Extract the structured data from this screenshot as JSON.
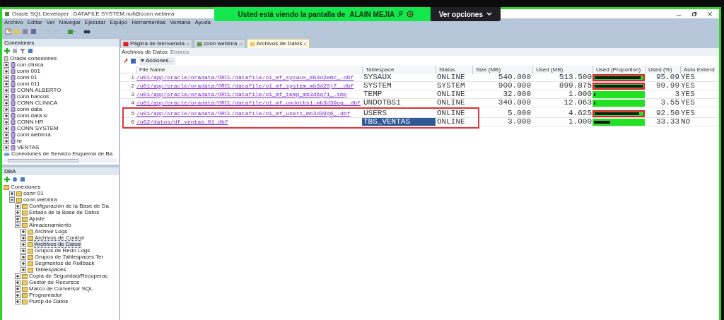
{
  "banner": {
    "text": "Usted está viendo la pantalla de",
    "presenter": "ALAIN MEJIA",
    "button": "Ver opciones"
  },
  "window": {
    "title": "Oracle SQL Developer : DATAFILE SYSTEM.null@conn webinra"
  },
  "menu": [
    "Archivo",
    "Editar",
    "Ver",
    "Navegar",
    "Ejecutar",
    "Equipo",
    "Herramientas",
    "Ventana",
    "Ayuda"
  ],
  "connections_panel": {
    "title": "Conexiones",
    "items": [
      {
        "kind": "root",
        "label": "Oracle conexiones"
      },
      {
        "kind": "connection",
        "label": "con clinica",
        "expanded": false
      },
      {
        "kind": "connection",
        "label": "conn 001",
        "expanded": false
      },
      {
        "kind": "connection",
        "label": "conn 01",
        "expanded": false
      },
      {
        "kind": "connection",
        "label": "conn 011",
        "expanded": false
      },
      {
        "kind": "connection",
        "label": "CONN ALBERTO",
        "expanded": false
      },
      {
        "kind": "connection",
        "label": "conn bancos",
        "expanded": false
      },
      {
        "kind": "connection",
        "label": "CONN CLINICA",
        "expanded": false
      },
      {
        "kind": "connection",
        "label": "conn data",
        "expanded": false
      },
      {
        "kind": "connection",
        "label": "conn data si",
        "expanded": false
      },
      {
        "kind": "connection",
        "label": "CONN HR",
        "expanded": false
      },
      {
        "kind": "connection",
        "label": "CONN SYSTEM",
        "expanded": false
      },
      {
        "kind": "connection",
        "label": "conn webinra",
        "expanded": false
      },
      {
        "kind": "connection",
        "label": "hr",
        "expanded": false
      },
      {
        "kind": "connection",
        "label": "VENTAS",
        "expanded": false
      },
      {
        "kind": "service",
        "label": "Conexiones de Servicio Esquema de Ba"
      }
    ]
  },
  "dba_panel": {
    "title": "DBA",
    "tree": [
      {
        "label": "Conexiones",
        "children": [
          {
            "label": "conn 01",
            "expanded": false
          },
          {
            "label": "conn webinra",
            "expanded": true,
            "children": [
              {
                "label": "Configuración de la Base de Da",
                "expanded": false
              },
              {
                "label": "Estado de la Base de Datos",
                "expanded": false
              },
              {
                "label": "Ajuste",
                "expanded": false
              },
              {
                "label": "Almacenamiento",
                "expanded": true,
                "children": [
                  {
                    "label": "Archive Logs",
                    "expanded": false,
                    "selected": false
                  },
                  {
                    "label": "Archivos de Control",
                    "expanded": false,
                    "selected": false
                  },
                  {
                    "label": "Archivos de Datos",
                    "expanded": false,
                    "selected": true
                  },
                  {
                    "label": "Grupos de Redo Logs",
                    "expanded": false,
                    "selected": false
                  },
                  {
                    "label": "Grupos de Tablespaces Ter",
                    "expanded": false,
                    "selected": false
                  },
                  {
                    "label": "Segmentos de Rollback",
                    "expanded": false,
                    "selected": false
                  },
                  {
                    "label": "Tablespaces",
                    "expanded": false,
                    "selected": false
                  }
                ]
              },
              {
                "label": "Copia de Seguridad/Recuperac",
                "expanded": false
              },
              {
                "label": "Gestor de Recursos",
                "expanded": false
              },
              {
                "label": "Marco de Conversor SQL",
                "expanded": false
              },
              {
                "label": "Programador",
                "expanded": false
              },
              {
                "label": "Pump de Datos",
                "expanded": false
              }
            ]
          }
        ]
      }
    ]
  },
  "doc_tabs": [
    {
      "label": "Página de bienvenida",
      "selected": false
    },
    {
      "label": "conn webinra",
      "selected": false
    },
    {
      "label": "Archivos de Datos",
      "selected": true
    }
  ],
  "sub_tabs": [
    {
      "label": "Archivos de Datos",
      "selected": true
    },
    {
      "label": "Errores",
      "selected": false
    }
  ],
  "actions": "Acciones...",
  "table": {
    "columns": [
      "File Name",
      "Tablespace",
      "Status",
      "Size (MB)",
      "Used (MB)",
      "Used (Proportion)",
      "Used (%)",
      "Auto Extend"
    ],
    "rows": [
      {
        "num": "1",
        "file": "/u01/app/oracle/oradata/ORCL/datafile/o1_mf_sysaux_mb3d2emc_.dbf",
        "tablespace": "SYSAUX",
        "status": "ONLINE",
        "size": "540.000",
        "used": "513.500",
        "level": 0.951,
        "alert": true,
        "pct": "95.09",
        "autoextend": "YES",
        "selected": false,
        "highlighted": false
      },
      {
        "num": "2",
        "file": "/u01/app/oracle/oradata/ORCL/datafile/o1_mf_system_mb3d20j7_.dbf",
        "tablespace": "SYSTEM",
        "status": "SYSTEM",
        "size": "900.000",
        "used": "899.875",
        "level": 0.9999,
        "alert": true,
        "pct": "99.99",
        "autoextend": "YES",
        "selected": false,
        "highlighted": false
      },
      {
        "num": "3",
        "file": "/u01/app/oracle/oradata/ORCL/datafile/o1_mf_temp_mb3d6g71_.tmp",
        "tablespace": "TEMP",
        "status": "ONLINE",
        "size": "32.000",
        "used": "1.000",
        "level": 0.031,
        "alert": false,
        "pct": "3",
        "autoextend": "YES",
        "selected": false,
        "highlighted": false
      },
      {
        "num": "4",
        "file": "/u01/app/oracle/oradata/ORCL/datafile/o1_mf_undotbs1_mb3d39og_.dbf",
        "tablespace": "UNDOTBS1",
        "status": "ONLINE",
        "size": "340.000",
        "used": "12.063",
        "level": 0.0355,
        "alert": false,
        "pct": "3.55",
        "autoextend": "YES",
        "selected": false,
        "highlighted": false
      },
      {
        "num": "5",
        "file": "/u01/app/oracle/oradata/ORCL/datafile/o1_mf_users_mb3d39g6_.dbf",
        "tablespace": "USERS",
        "status": "ONLINE",
        "size": "5.000",
        "used": "4.625",
        "level": 0.925,
        "alert": true,
        "pct": "92.50",
        "autoextend": "YES",
        "selected": false,
        "highlighted": true
      },
      {
        "num": "6",
        "file": "/u02/datos/df_ventas_01.dbf",
        "tablespace": "TBS_VENTAS",
        "status": "ONLINE",
        "size": "3.000",
        "used": "1.000",
        "level": 0.333,
        "alert": false,
        "pct": "33.33",
        "autoextend": "NO",
        "selected": true,
        "highlighted": true
      }
    ]
  }
}
